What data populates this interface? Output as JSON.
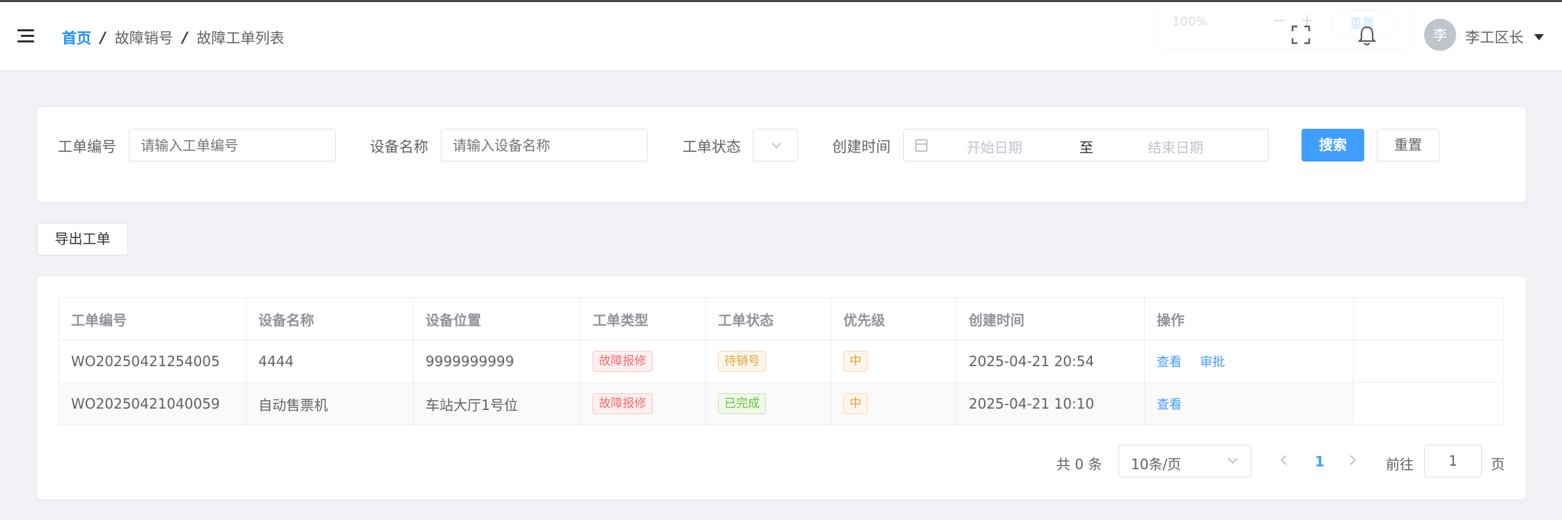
{
  "header": {
    "breadcrumb": [
      "首页",
      "故障销号",
      "故障工单列表"
    ],
    "breadcrumb_sep": "/",
    "zoom": {
      "value": "100%",
      "minus": "−",
      "plus": "+",
      "reset": "重置"
    },
    "avatar_text": "李",
    "username": "李工区长"
  },
  "search": {
    "order_no_label": "工单编号",
    "order_no_placeholder": "请输入工单编号",
    "device_label": "设备名称",
    "device_placeholder": "请输入设备名称",
    "status_label": "工单状态",
    "created_label": "创建时间",
    "start_placeholder": "开始日期",
    "range_sep": "至",
    "end_placeholder": "结束日期",
    "search_button": "搜索",
    "reset_button": "重置"
  },
  "toolbar": {
    "export_button": "导出工单"
  },
  "table": {
    "columns": [
      "工单编号",
      "设备名称",
      "设备位置",
      "工单类型",
      "工单状态",
      "优先级",
      "创建时间",
      "操作"
    ],
    "rows": [
      {
        "order_no": "WO20250421254005",
        "device": "4444",
        "location": "9999999999",
        "type": "故障报修",
        "status": "待销号",
        "priority": "中",
        "created": "2025-04-21 20:54",
        "actions": [
          "查看",
          "审批"
        ]
      },
      {
        "order_no": "WO20250421040059",
        "device": "自动售票机",
        "location": "车站大厅1号位",
        "type": "故障报修",
        "status": "已完成",
        "priority": "中",
        "created": "2025-04-21 10:10",
        "actions": [
          "查看"
        ]
      }
    ]
  },
  "pagination": {
    "total": "共 0 条",
    "page_size": "10条/页",
    "current_page": "1",
    "goto_label": "前往",
    "goto_value": "1",
    "page_suffix": "页"
  },
  "colors": {
    "primary": "#409eff",
    "danger": "#f56c6c",
    "warning": "#e6a23c",
    "success": "#67c23a"
  }
}
